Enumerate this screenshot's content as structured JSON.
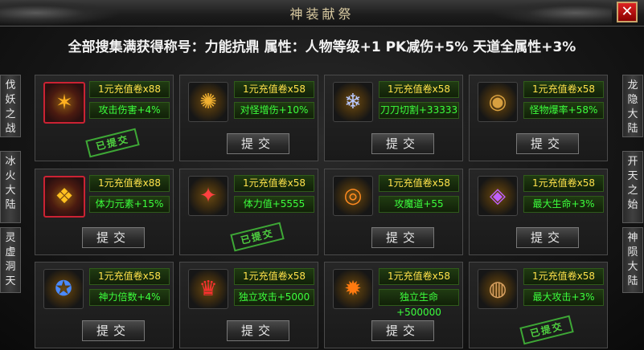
{
  "window": {
    "title": "神装献祭",
    "close_label": "✕"
  },
  "header": {
    "text": "全部搜集满获得称号：力能抗鼎  属性：人物等级+1 PK减伤+5% 天道全属性+3%"
  },
  "left_tabs": [
    {
      "label": "伐妖之战"
    },
    {
      "label": "冰火大陆"
    },
    {
      "label": "灵虚洞天"
    }
  ],
  "right_tabs": [
    {
      "label": "龙隐大陆"
    },
    {
      "label": "开天之始"
    },
    {
      "label": "神陨大陆"
    }
  ],
  "submit_label": "提交",
  "submitted_label": "已提交",
  "cards": [
    {
      "reward": "1元充值卷x88",
      "attr": "攻击伤害+4%",
      "submitted": true,
      "icon": "golden-wing-icon",
      "glyph": "✶",
      "color": "#ffb020",
      "highlight": true
    },
    {
      "reward": "1元充值卷x58",
      "attr": "对怪增伤+10%",
      "submitted": false,
      "icon": "golden-flower-icon",
      "glyph": "✺",
      "color": "#f0b030",
      "highlight": false
    },
    {
      "reward": "1元充值卷x58",
      "attr": "刀刀切割+33333",
      "submitted": false,
      "icon": "silver-dragon-icon",
      "glyph": "❄",
      "color": "#b8c8ff",
      "highlight": false
    },
    {
      "reward": "1元充值卷x58",
      "attr": "怪物爆率+58%",
      "submitted": false,
      "icon": "gold-ring-icon",
      "glyph": "◉",
      "color": "#d8a040",
      "highlight": false
    },
    {
      "reward": "1元充值卷x88",
      "attr": "体力元素+15%",
      "submitted": false,
      "icon": "golden-phoenix-icon",
      "glyph": "❖",
      "color": "#ffc020",
      "highlight": true
    },
    {
      "reward": "1元充值卷x58",
      "attr": "体力值+5555",
      "submitted": true,
      "icon": "red-armor-icon",
      "glyph": "✦",
      "color": "#ff4040",
      "highlight": false
    },
    {
      "reward": "1元充值卷x58",
      "attr": "攻魔道+55",
      "submitted": false,
      "icon": "fire-ring-icon",
      "glyph": "◎",
      "color": "#ff8a20",
      "highlight": false
    },
    {
      "reward": "1元充值卷x58",
      "attr": "最大生命+3%",
      "submitted": false,
      "icon": "purple-ring-icon",
      "glyph": "◈",
      "color": "#c060ff",
      "highlight": false
    },
    {
      "reward": "1元充值卷x58",
      "attr": "神力倍数+4%",
      "submitted": false,
      "icon": "blue-ring-icon",
      "glyph": "✪",
      "color": "#4a8aff",
      "highlight": false
    },
    {
      "reward": "1元充值卷x58",
      "attr": "独立攻击+5000",
      "submitted": false,
      "icon": "red-crest-icon",
      "glyph": "♛",
      "color": "#ff3030",
      "highlight": false
    },
    {
      "reward": "1元充值卷x58",
      "attr": "独立生命+500000",
      "submitted": false,
      "icon": "flame-ring-icon",
      "glyph": "✹",
      "color": "#ff7a10",
      "highlight": false
    },
    {
      "reward": "1元充值卷x58",
      "attr": "最大攻击+3%",
      "submitted": true,
      "icon": "bronze-ring-icon",
      "glyph": "◍",
      "color": "#d8a060",
      "highlight": false
    }
  ]
}
